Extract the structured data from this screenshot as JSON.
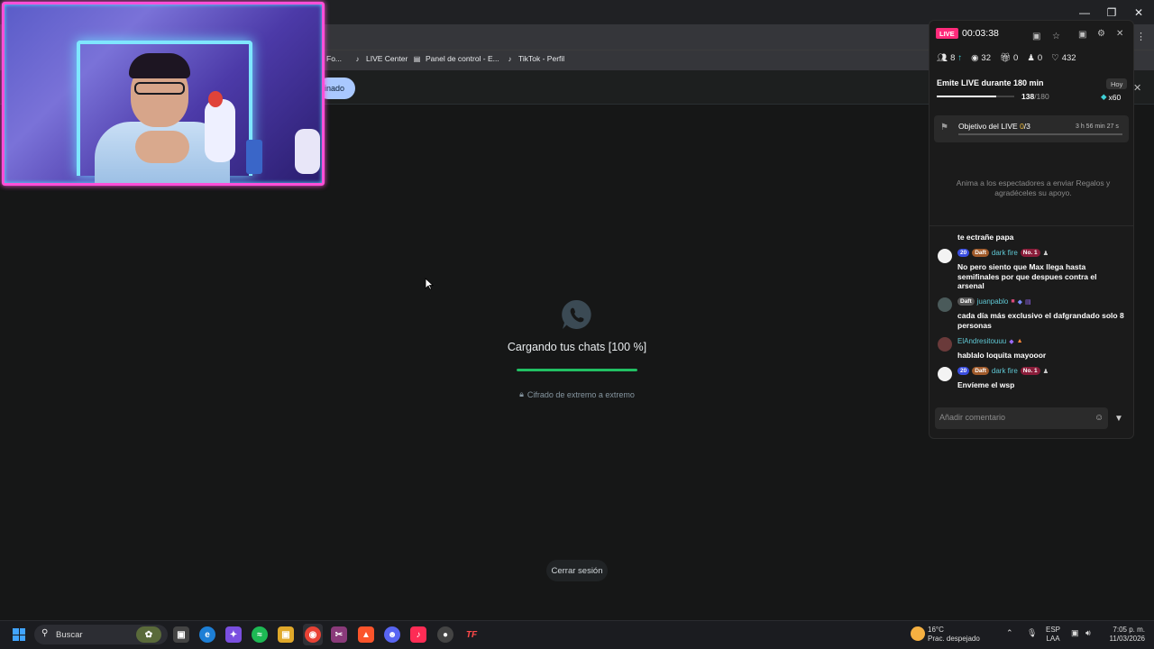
{
  "browser": {
    "bookmarks": [
      {
        "label": "Fo...",
        "icon": "bookmark-icon"
      },
      {
        "label": "LIVE Center",
        "icon": "tiktok-icon"
      },
      {
        "label": "Panel de control - E...",
        "icon": "document-icon"
      },
      {
        "label": "TikTok - Perfil",
        "icon": "tiktok-icon"
      }
    ],
    "chip_label": "inado"
  },
  "whatsapp": {
    "loading_text": "Cargando tus chats [100 %]",
    "progress_percent": 100,
    "encryption_text": "Cifrado de extremo a extremo",
    "logout_label": "Cerrar sesión",
    "accent": "#21c063"
  },
  "live_panel": {
    "badge": "LIVE",
    "timer": "00:03:38",
    "stats": {
      "viewers": "8",
      "views": "32",
      "gifts": "0",
      "shares": "0",
      "likes": "432"
    },
    "goal": {
      "title": "Emite LIVE durante 180 min",
      "today_label": "Hoy",
      "current": "138",
      "total": "/180",
      "progress_fraction": 0.767,
      "reward": "x60"
    },
    "objective": {
      "title": "Objetivo del LIVE",
      "count": "0",
      "total": "/3",
      "time_left": "3 h 56 min 27 s"
    },
    "encourage_text": "Anima a los espectadores a enviar Regalos y agradéceles su apoyo.",
    "messages": [
      {
        "user": "",
        "badges": [],
        "text": "te ectrañe papa"
      },
      {
        "user": "dark fire",
        "badges": [
          "20",
          "Daft",
          "No. 1"
        ],
        "text": "No pero siento que Max llega hasta semifinales por que despues contra el arsenal"
      },
      {
        "user": "juanpablo",
        "badges": [
          "Daft"
        ],
        "text": "cada día más exclusivo el dafgrandado solo 8 personas"
      },
      {
        "user": "ElAndresitouuu",
        "badges": [],
        "text": "hablalo loquita mayooor"
      },
      {
        "user": "dark fire",
        "badges": [
          "20",
          "Daft",
          "No. 1"
        ],
        "text": "Envíeme el wsp"
      }
    ],
    "comment_placeholder": "Añadir comentario",
    "accent": "#ff2b7b"
  },
  "taskbar": {
    "search_placeholder": "Buscar",
    "weather_temp": "16°C",
    "weather_desc": "Prac. despejado",
    "lang_line1": "ESP",
    "lang_line2": "LAA",
    "time": "7:05 p. m.",
    "date": "11/03/2026"
  }
}
